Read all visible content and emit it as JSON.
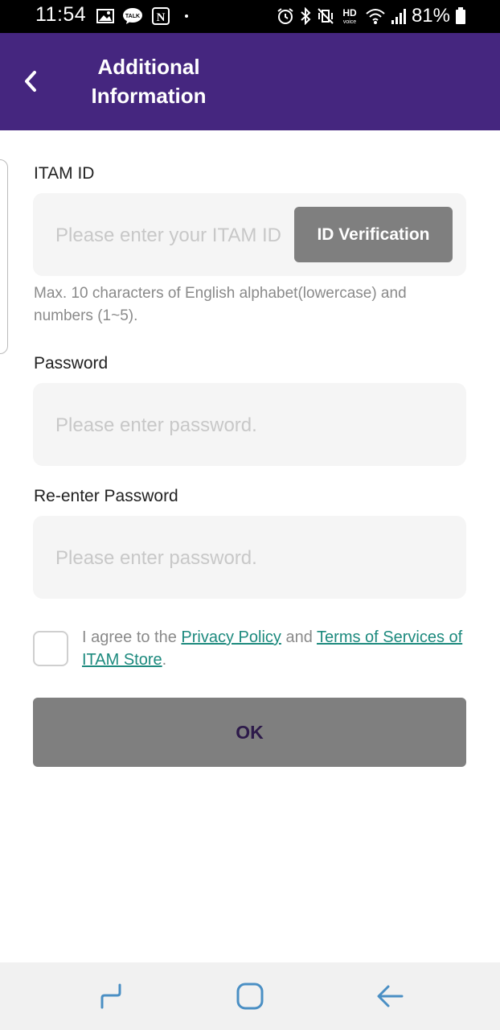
{
  "status_bar": {
    "time": "11:54",
    "battery": "81%",
    "hd_label": "HD",
    "voice_label": "voice",
    "talk_label": "TALK",
    "notion_label": "N"
  },
  "app_bar": {
    "title": "Additional Information"
  },
  "form": {
    "itam_id": {
      "label": "ITAM ID",
      "placeholder": "Please enter your ITAM ID",
      "verify_button": "ID Verification",
      "hint": "Max. 10 characters of English alphabet(lowercase) and numbers (1~5)."
    },
    "password": {
      "label": "Password",
      "placeholder": "Please enter password."
    },
    "reenter_password": {
      "label": "Re-enter Password",
      "placeholder": "Please enter password."
    },
    "agreement": {
      "prefix": "I agree to the ",
      "privacy_link": "Privacy Policy",
      "middle": " and ",
      "terms_link": "Terms of Services of ITAM Store",
      "suffix": "."
    },
    "ok_button": "OK"
  },
  "colors": {
    "app_bar": "#45267f",
    "button_gray": "#7f7f7f",
    "link": "#1d8a7e",
    "nav_icon": "#4a8fc4"
  },
  "nav_bar": {
    "icons": [
      "recent-apps-icon",
      "home-icon",
      "back-icon"
    ]
  }
}
